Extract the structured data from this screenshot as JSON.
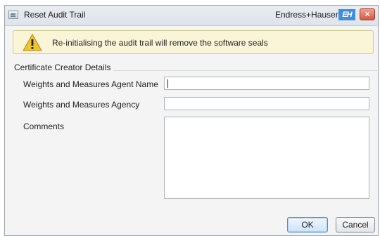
{
  "window": {
    "title": "Reset Audit Trail",
    "brand": "Endress+Hauser",
    "brand_logo": "EH",
    "close_glyph": "×"
  },
  "banner": {
    "icon": "warning-icon",
    "message": "Re-initialising the audit trail will remove the software seals"
  },
  "form": {
    "group_title": "Certificate Creator Details",
    "agent_name_label": "Weights and Measures Agent Name",
    "agent_name_value": "",
    "agency_label": "Weights and Measures Agency",
    "agency_value": "",
    "comments_label": "Comments",
    "comments_value": ""
  },
  "buttons": {
    "ok": "OK",
    "cancel": "Cancel"
  },
  "colors": {
    "banner_background": "#fbf5d8",
    "warning": "#f2c230",
    "brand_accent": "#3f8fe0",
    "close_button": "#d25a45"
  }
}
